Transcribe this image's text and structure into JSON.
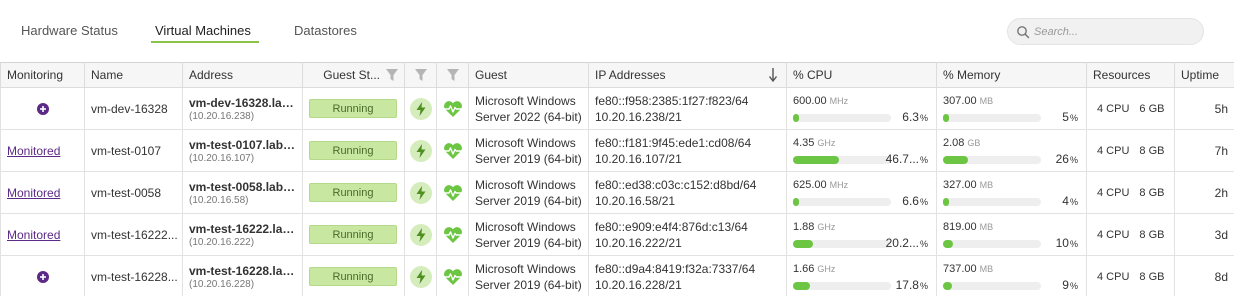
{
  "tabs": [
    {
      "label": "Hardware Status"
    },
    {
      "label": "Virtual Machines"
    },
    {
      "label": "Datastores"
    }
  ],
  "search": {
    "placeholder": "Search..."
  },
  "columns": {
    "monitoring": "Monitoring",
    "name": "Name",
    "address": "Address",
    "guest_state": "Guest St...",
    "guest": "Guest",
    "ip": "IP Addresses",
    "cpu": "% CPU",
    "memory": "% Memory",
    "resources": "Resources",
    "uptime": "Uptime"
  },
  "colors": {
    "accent": "#8bc34a",
    "running_bg": "#c8e8a2",
    "bar_fill": "#6cc644",
    "monitored_link": "#5b2a86"
  },
  "rows": [
    {
      "monitoring": {
        "type": "add-icon",
        "label": ""
      },
      "name": "vm-dev-16328",
      "address": "vm-dev-16328.lab...",
      "address_ip": "(10.20.16.238)",
      "status": "Running",
      "guest_line1": "Microsoft Windows",
      "guest_line2": "Server 2022 (64-bit)",
      "ip_line1": "fe80::f958:2385:1f27:f823/64",
      "ip_line2": "10.20.16.238/21",
      "cpu_value": "600.00",
      "cpu_unit": "MHz",
      "cpu_pct": "6.3",
      "cpu_frac": 0.063,
      "mem_value": "307.00",
      "mem_unit": "MB",
      "mem_pct": "5",
      "mem_frac": 0.05,
      "res_cpu": "4 CPU",
      "res_mem": "6 GB",
      "uptime": "5h"
    },
    {
      "monitoring": {
        "type": "link",
        "label": "Monitored"
      },
      "name": "vm-test-0107",
      "address": "vm-test-0107.lab.a...",
      "address_ip": "(10.20.16.107)",
      "status": "Running",
      "guest_line1": "Microsoft Windows",
      "guest_line2": "Server 2019 (64-bit)",
      "ip_line1": "fe80::f181:9f45:ede1:cd08/64",
      "ip_line2": "10.20.16.107/21",
      "cpu_value": "4.35",
      "cpu_unit": "GHz",
      "cpu_pct": "46.7...",
      "cpu_frac": 0.467,
      "mem_value": "2.08",
      "mem_unit": "GB",
      "mem_pct": "26",
      "mem_frac": 0.26,
      "res_cpu": "4 CPU",
      "res_mem": "8 GB",
      "uptime": "7h"
    },
    {
      "monitoring": {
        "type": "link",
        "label": "Monitored"
      },
      "name": "vm-test-0058",
      "address": "vm-test-0058.lab....",
      "address_ip": "(10.20.16.58)",
      "status": "Running",
      "guest_line1": "Microsoft Windows",
      "guest_line2": "Server 2019 (64-bit)",
      "ip_line1": "fe80::ed38:c03c:c152:d8bd/64",
      "ip_line2": "10.20.16.58/21",
      "cpu_value": "625.00",
      "cpu_unit": "MHz",
      "cpu_pct": "6.6",
      "cpu_frac": 0.066,
      "mem_value": "327.00",
      "mem_unit": "MB",
      "mem_pct": "4",
      "mem_frac": 0.04,
      "res_cpu": "4 CPU",
      "res_mem": "8 GB",
      "uptime": "2h"
    },
    {
      "monitoring": {
        "type": "link",
        "label": "Monitored"
      },
      "name": "vm-test-16222...",
      "address": "vm-test-16222.lab...",
      "address_ip": "(10.20.16.222)",
      "status": "Running",
      "guest_line1": "Microsoft Windows",
      "guest_line2": "Server 2019 (64-bit)",
      "ip_line1": "fe80::e909:e4f4:876d:c13/64",
      "ip_line2": "10.20.16.222/21",
      "cpu_value": "1.88",
      "cpu_unit": "GHz",
      "cpu_pct": "20.2...",
      "cpu_frac": 0.202,
      "mem_value": "819.00",
      "mem_unit": "MB",
      "mem_pct": "10",
      "mem_frac": 0.1,
      "res_cpu": "4 CPU",
      "res_mem": "8 GB",
      "uptime": "3d"
    },
    {
      "monitoring": {
        "type": "add-icon",
        "label": ""
      },
      "name": "vm-test-16228...",
      "address": "vm-test-16228.lab...",
      "address_ip": "(10.20.16.228)",
      "status": "Running",
      "guest_line1": "Microsoft Windows",
      "guest_line2": "Server 2019 (64-bit)",
      "ip_line1": "fe80::d9a4:8419:f32a:7337/64",
      "ip_line2": "10.20.16.228/21",
      "cpu_value": "1.66",
      "cpu_unit": "GHz",
      "cpu_pct": "17.8",
      "cpu_frac": 0.178,
      "mem_value": "737.00",
      "mem_unit": "MB",
      "mem_pct": "9",
      "mem_frac": 0.09,
      "res_cpu": "4 CPU",
      "res_mem": "8 GB",
      "uptime": "8d"
    }
  ]
}
